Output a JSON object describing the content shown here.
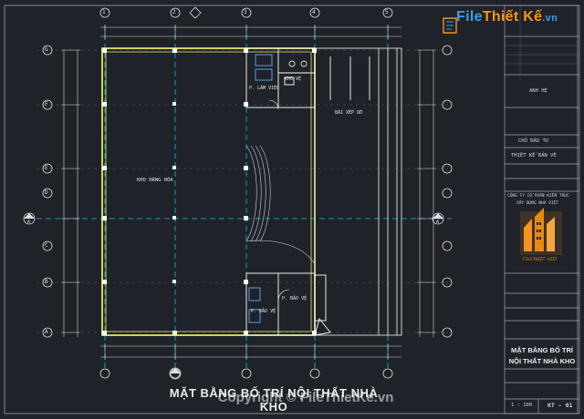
{
  "watermark": {
    "brand": "File",
    "brand2": "Thiết Kế",
    "domain": ".vn",
    "copyright": "Copyright © FileThietKe.vn"
  },
  "drawing": {
    "title": "MẶT BẰNG BỐ TRÍ NỘI THẤT NHÀ KHO",
    "rooms": {
      "warehouse": "KHO HÀNG HÓA",
      "office1": "P. LÀM VIỆC",
      "wc": "KHO VỆ",
      "loading": "BÃI XẾP DỠ",
      "guard1": "P. BẢO VỆ",
      "guard2": "P. BẢO VỆ",
      "garage": "BÃI ĐỖ XE"
    },
    "grid_top": [
      "1",
      "2",
      "3",
      "4",
      "5",
      "6",
      "7"
    ],
    "grid_left": [
      "G",
      "F",
      "E",
      "D",
      "C",
      "B",
      "A"
    ],
    "section_marker": "A"
  },
  "title_block": {
    "r1": "ANH HỆ",
    "r2": "CHỦ ĐẦU TƯ",
    "r3": "THIẾT KẾ BẢN VẼ",
    "company": "CÔNG TY CỔ PHẦN KIẾN TRÚC",
    "company2": "XÂY DỰNG NHÀ VIỆT",
    "logo_caption": "FILETHIẾT VIỆT",
    "drawing_title_1": "MẶT BẰNG BỐ TRÍ",
    "drawing_title_2": "NỘI THẤT NHÀ KHO",
    "scale": "1 : 100",
    "sheet": "KT - 01"
  },
  "colors": {
    "background": "#1f2228",
    "wall": "#ffff66",
    "grid": "#00c8e6",
    "dim": "#e8e8e8",
    "accent_orange": "#f7931e",
    "accent_blue": "#3aa0e8"
  }
}
